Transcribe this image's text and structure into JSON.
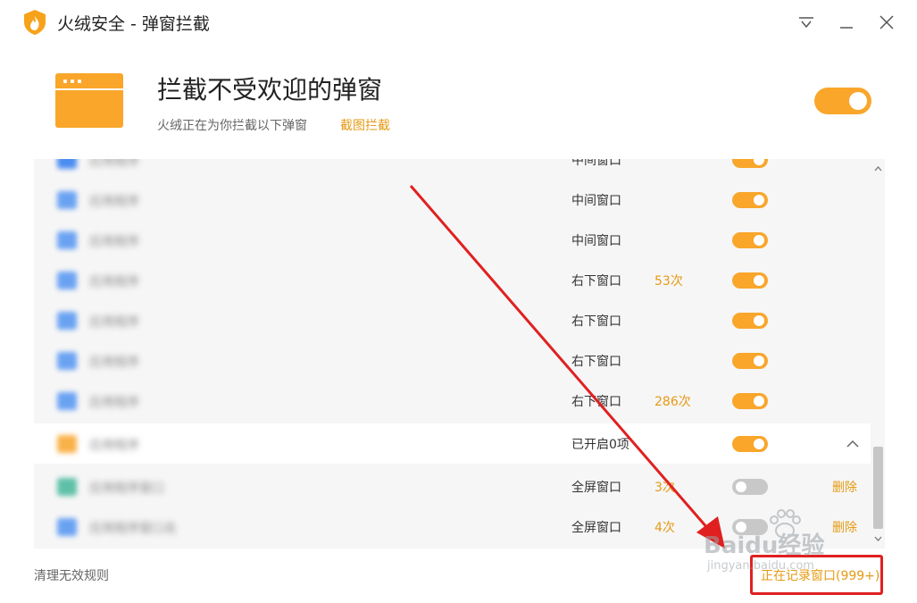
{
  "window": {
    "title": "火绒安全 - 弹窗拦截",
    "controls": [
      "menu-icon",
      "minimize-icon",
      "close-icon"
    ]
  },
  "header": {
    "title": "拦截不受欢迎的弹窗",
    "subtitle": "火绒正在为你拦截以下弹窗",
    "screenshot_link": "截图拦截",
    "master_toggle": "on"
  },
  "rules": [
    {
      "type": "中间窗口",
      "count": "",
      "toggle": "on",
      "icon_color": "#4a8cf0"
    },
    {
      "type": "中间窗口",
      "count": "",
      "toggle": "on",
      "icon_color": "#6aa2f2"
    },
    {
      "type": "中间窗口",
      "count": "",
      "toggle": "on",
      "icon_color": "#6aa2f2"
    },
    {
      "type": "右下窗口",
      "count": "53次",
      "toggle": "on",
      "icon_color": "#6aa2f2"
    },
    {
      "type": "右下窗口",
      "count": "",
      "toggle": "on",
      "icon_color": "#6aa2f2"
    },
    {
      "type": "右下窗口",
      "count": "",
      "toggle": "on",
      "icon_color": "#6aa2f2"
    },
    {
      "type": "右下窗口",
      "count": "286次",
      "toggle": "on",
      "icon_color": "#6aa2f2"
    }
  ],
  "group": {
    "status": "已开启0项",
    "toggle": "on",
    "icon_color": "#f9b24a"
  },
  "subrules": [
    {
      "type": "全屏窗口",
      "count": "3次",
      "toggle": "off",
      "action": "删除",
      "icon_color": "#5fc0a8"
    },
    {
      "type": "全屏窗口",
      "count": "4次",
      "toggle": "off",
      "action": "删除",
      "icon_color": "#6aa2f2"
    }
  ],
  "footer": {
    "clean_link": "清理无效规则",
    "recording_link": "正在记录窗口(999+)"
  },
  "watermark": {
    "brand": "Baidu经验",
    "domain": "jingyan.baidu.com"
  },
  "colors": {
    "accent": "#f9a62b",
    "link": "#e59a14",
    "annotation": "#e02020"
  }
}
